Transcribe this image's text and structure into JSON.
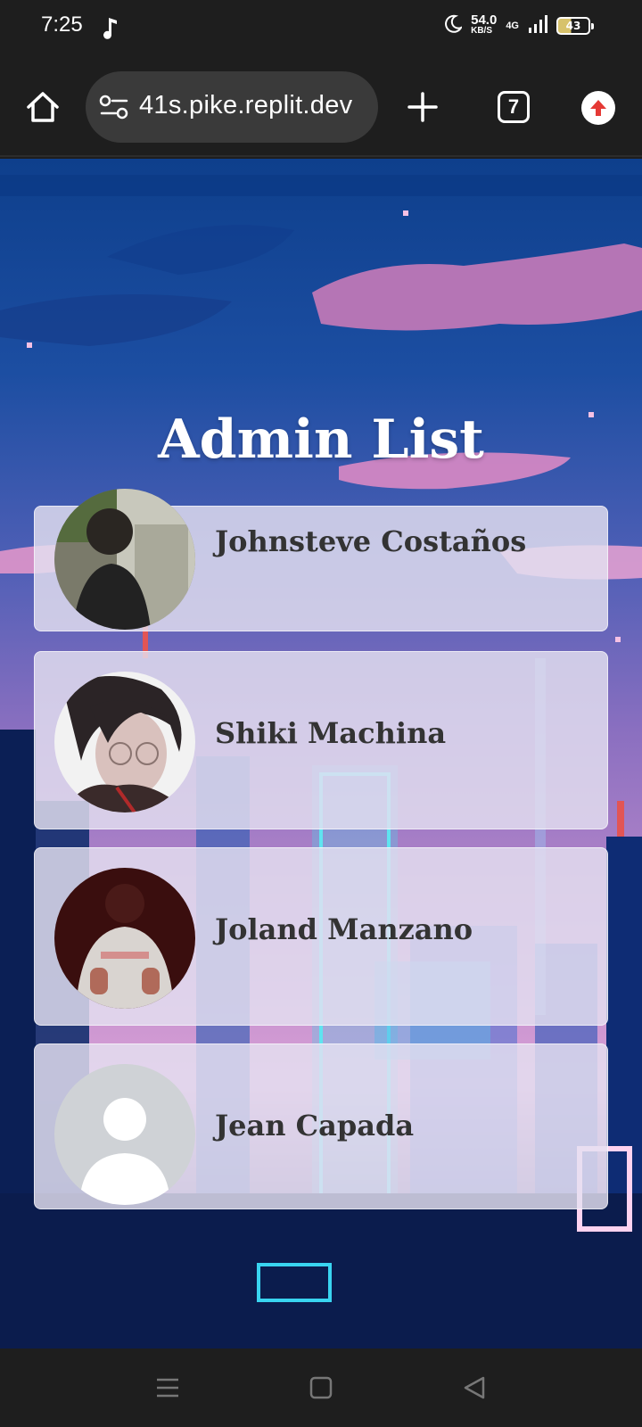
{
  "status_bar": {
    "time": "7:25",
    "net_speed_value": "54.0",
    "net_speed_unit": "KB/S",
    "network_type": "4G",
    "battery_level": "43",
    "icons": [
      "music-note-icon",
      "moon-icon",
      "signal-icon",
      "battery-icon"
    ]
  },
  "browser": {
    "url": "41s.pike.replit.dev",
    "tab_count": "7",
    "icons": [
      "home-icon",
      "site-settings-icon",
      "plus-icon",
      "tabs-icon",
      "update-icon"
    ]
  },
  "page": {
    "title": "Admin List",
    "admins": [
      {
        "name": "Johnsteve Costaños",
        "avatar": "photo"
      },
      {
        "name": "Shiki Machina",
        "avatar": "photo"
      },
      {
        "name": "Joland Manzano",
        "avatar": "photo"
      },
      {
        "name": "Jean Capada",
        "avatar": "default-user"
      }
    ]
  },
  "nav_bar": {
    "icons": [
      "menu-icon",
      "home-square-icon",
      "back-icon"
    ]
  },
  "colors": {
    "title_text": "#ffffff",
    "card_bg": "#e4e0f0",
    "name_text": "#333333",
    "update_badge": "#e53935"
  }
}
